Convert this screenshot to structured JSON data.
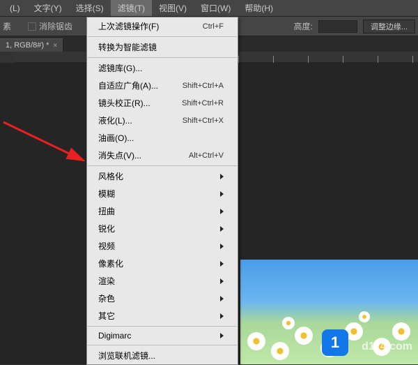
{
  "menubar": {
    "items": [
      {
        "label": "(L)"
      },
      {
        "label": "文字(Y)"
      },
      {
        "label": "选择(S)"
      },
      {
        "label": "滤镜(T)"
      },
      {
        "label": "视图(V)"
      },
      {
        "label": "窗口(W)"
      },
      {
        "label": "帮助(H)"
      }
    ],
    "active_index": 3
  },
  "toolbar": {
    "mode_label": "素",
    "antialias_label": "消除锯齿",
    "height_label": "高度:",
    "height_value": "",
    "refine_edge_label": "调整边缘..."
  },
  "doc_tab": {
    "title": "1, RGB/8#) *",
    "close_glyph": "×"
  },
  "dropdown": {
    "sections": [
      [
        {
          "label": "上次滤镜操作(F)",
          "shortcut": "Ctrl+F",
          "submenu": false
        }
      ],
      [
        {
          "label": "转换为智能滤镜",
          "shortcut": "",
          "submenu": false
        }
      ],
      [
        {
          "label": "滤镜库(G)...",
          "shortcut": "",
          "submenu": false
        },
        {
          "label": "自适应广角(A)...",
          "shortcut": "Shift+Ctrl+A",
          "submenu": false
        },
        {
          "label": "镜头校正(R)...",
          "shortcut": "Shift+Ctrl+R",
          "submenu": false
        },
        {
          "label": "液化(L)...",
          "shortcut": "Shift+Ctrl+X",
          "submenu": false
        },
        {
          "label": "油画(O)...",
          "shortcut": "",
          "submenu": false
        },
        {
          "label": "消失点(V)...",
          "shortcut": "Alt+Ctrl+V",
          "submenu": false
        }
      ],
      [
        {
          "label": "风格化",
          "shortcut": "",
          "submenu": true
        },
        {
          "label": "模糊",
          "shortcut": "",
          "submenu": true
        },
        {
          "label": "扭曲",
          "shortcut": "",
          "submenu": true
        },
        {
          "label": "锐化",
          "shortcut": "",
          "submenu": true
        },
        {
          "label": "视频",
          "shortcut": "",
          "submenu": true
        },
        {
          "label": "像素化",
          "shortcut": "",
          "submenu": true
        },
        {
          "label": "渲染",
          "shortcut": "",
          "submenu": true
        },
        {
          "label": "杂色",
          "shortcut": "",
          "submenu": true
        },
        {
          "label": "其它",
          "shortcut": "",
          "submenu": true
        }
      ],
      [
        {
          "label": "Digimarc",
          "shortcut": "",
          "submenu": true
        }
      ],
      [
        {
          "label": "浏览联机滤镜...",
          "shortcut": "",
          "submenu": false
        }
      ]
    ]
  },
  "watermark": {
    "logo_text": "1",
    "site_text": "d1z4.com"
  }
}
